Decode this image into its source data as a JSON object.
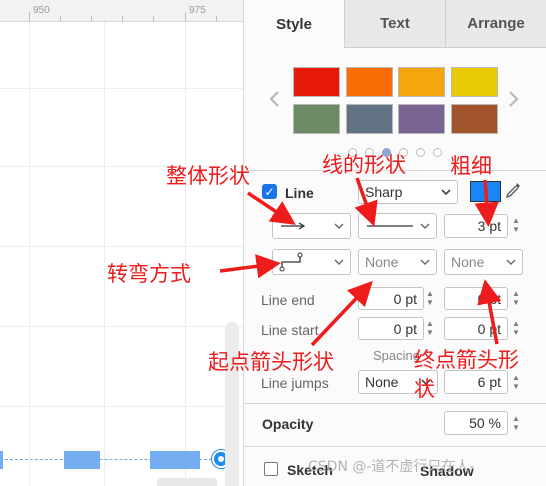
{
  "ruler": {
    "ticks": [
      "950",
      "975"
    ]
  },
  "tabs": [
    "Style",
    "Text",
    "Arrange"
  ],
  "palette": {
    "row1": [
      "#e81a0c",
      "#fb6d06",
      "#f5a60d",
      "#e7c904"
    ],
    "row2": [
      "#6c8a63",
      "#627385",
      "#7a6493",
      "#a2542d"
    ],
    "prev_icon": "chevron-left-icon",
    "next_icon": "chevron-right-icon",
    "page_count": 5,
    "active_page": 2
  },
  "line": {
    "checked": true,
    "label": "Line",
    "style_value": "Sharp",
    "color": "#1a86f6",
    "width_value": "3 pt",
    "waypoint_value": "None",
    "line_end_arrow": "None"
  },
  "line_end": {
    "label": "Line end",
    "size": "0 pt",
    "spacing": "0 pt"
  },
  "line_start": {
    "label": "Line start",
    "size": "0 pt",
    "spacing": "0 pt"
  },
  "spacing_label": "Spacing",
  "line_jumps": {
    "label": "Line jumps",
    "value": "None",
    "size": "6 pt"
  },
  "opacity": {
    "label": "Opacity",
    "value": "50 %"
  },
  "sketch": {
    "label": "Sketch",
    "checked": false
  },
  "shadow": {
    "label": "Shadow"
  },
  "annotations": {
    "overall_shape": "整体形状",
    "line_shape": "线的形状",
    "thickness": "粗细",
    "turning_style": "转弯方式",
    "start_arrow_shape": "起点箭头形状",
    "end_arrow_shape_a": "终点箭头形",
    "end_arrow_shape_b": "状"
  },
  "watermark": "CSDN @-道不虚行只在人-"
}
